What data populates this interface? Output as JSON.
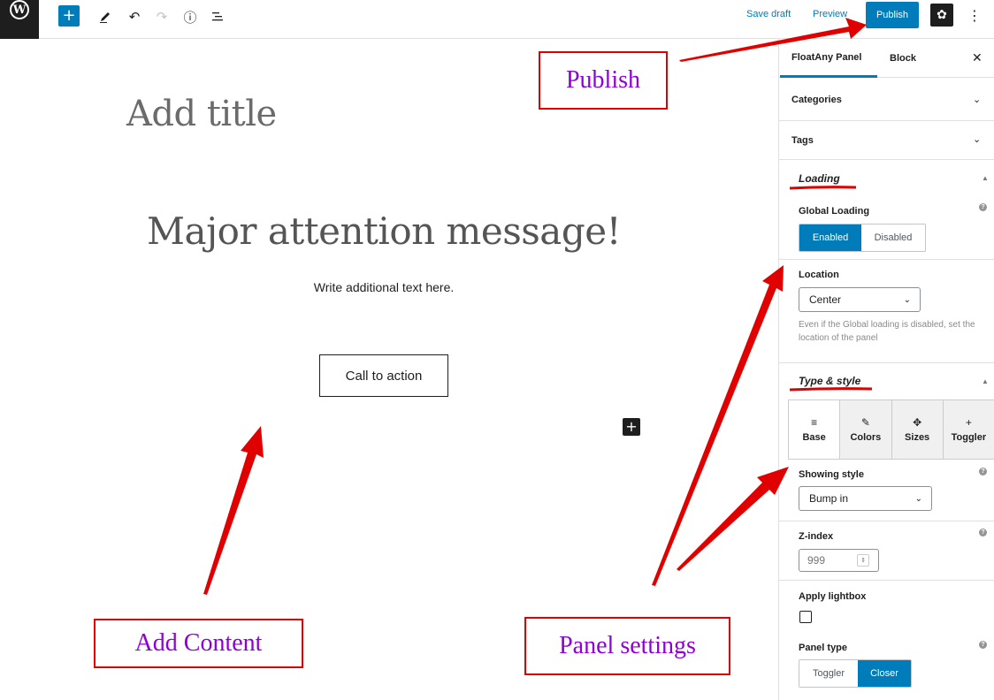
{
  "toolbar": {
    "logo_letter": "W",
    "add_icon": "plus-icon",
    "edit_icon": "pencil-icon",
    "undo_icon": "undo-icon",
    "redo_icon": "redo-icon",
    "info_icon": "info-icon",
    "list_icon": "list-view-icon",
    "save_draft_label": "Save draft",
    "preview_label": "Preview",
    "publish_label": "Publish",
    "settings_icon": "gear-icon",
    "more_icon": "vertical-ellipsis-icon",
    "accent_color": "#007cba"
  },
  "editor": {
    "title_placeholder": "Add title",
    "heading": "Major attention message!",
    "subtext": "Write additional text here.",
    "cta_label": "Call to action",
    "block_inserter_icon": "plus-icon"
  },
  "sidebar": {
    "tabs": [
      {
        "label": "FloatAny Panel",
        "active": true
      },
      {
        "label": "Block",
        "active": false
      }
    ],
    "close_icon": "close-icon",
    "rows": [
      {
        "label": "Categories",
        "icon": "chevron-down-icon"
      },
      {
        "label": "Tags",
        "icon": "chevron-down-icon"
      }
    ],
    "loading": {
      "title": "Loading",
      "global_loading_label": "Global Loading",
      "enabled_label": "Enabled",
      "disabled_label": "Disabled",
      "selected": "Enabled",
      "location_label": "Location",
      "location_value": "Center",
      "location_hint": "Even if the Global loading is disabled, set the location of the panel"
    },
    "type_style": {
      "title": "Type & style",
      "tabs": [
        {
          "label": "Base",
          "icon": "sliders-icon",
          "glyph": "≡",
          "active": true
        },
        {
          "label": "Colors",
          "icon": "brush-icon",
          "glyph": "✎",
          "active": false
        },
        {
          "label": "Sizes",
          "icon": "move-icon",
          "glyph": "✥",
          "active": false
        },
        {
          "label": "Toggler",
          "icon": "plus-icon",
          "glyph": "+",
          "active": false
        }
      ],
      "showing_style_label": "Showing style",
      "showing_style_value": "Bump in",
      "zindex_label": "Z-index",
      "zindex_value": "999",
      "lightbox_label": "Apply lightbox",
      "lightbox_checked": false,
      "panel_type_label": "Panel type",
      "toggler_label": "Toggler",
      "closer_label": "Closer",
      "panel_type_selected": "Closer"
    }
  },
  "annotations": {
    "publish": "Publish",
    "add_content": "Add Content",
    "panel_settings": "Panel settings",
    "color": "#e00000",
    "text_color": "#8f00d8"
  }
}
